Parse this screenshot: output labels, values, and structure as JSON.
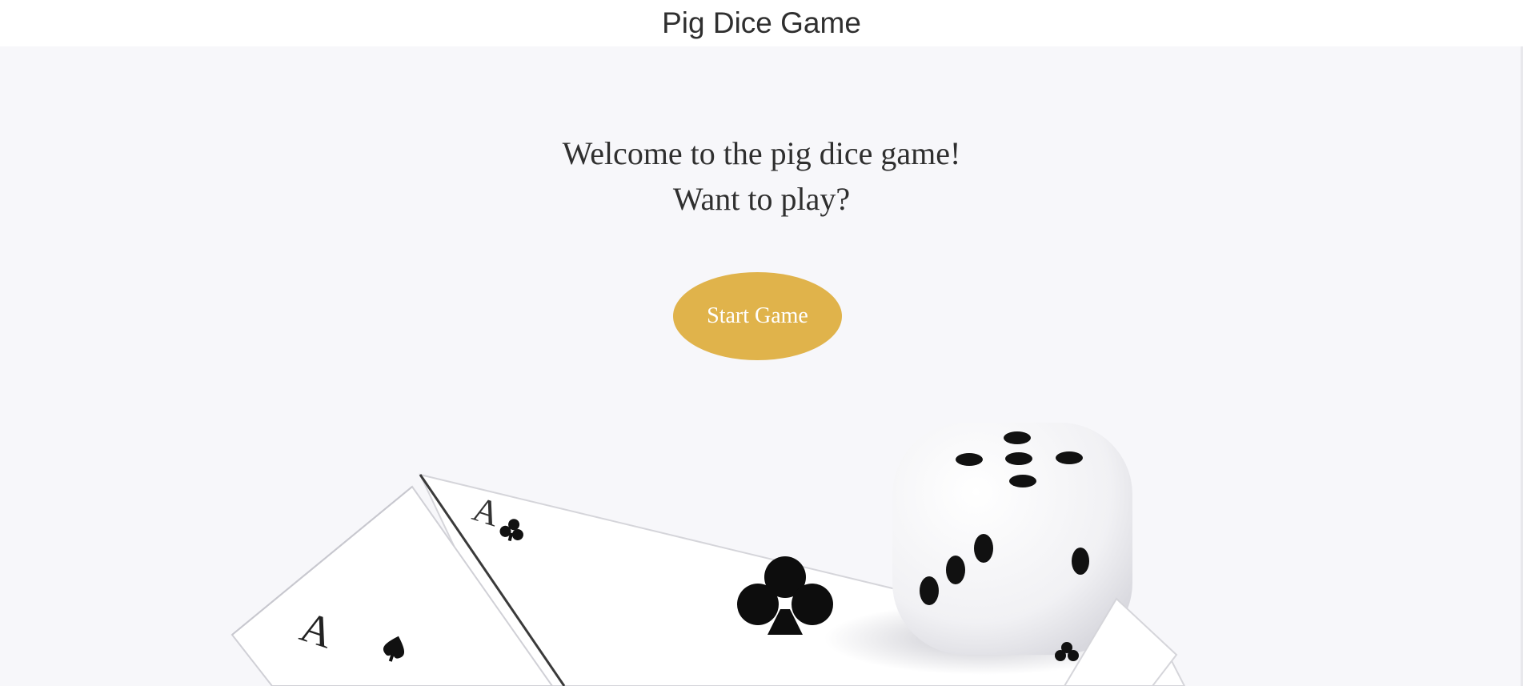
{
  "header": {
    "title": "Pig Dice Game"
  },
  "hero": {
    "welcome_line": "Welcome to the pig dice game!",
    "question_line": "Want to play?",
    "start_button_label": "Start Game",
    "background_image": "dice-and-ace-cards-photo"
  },
  "colors": {
    "button": "#e0b34b",
    "button_text": "#ffffff",
    "text": "#2f2f2f",
    "background": "#f7f7fa"
  }
}
